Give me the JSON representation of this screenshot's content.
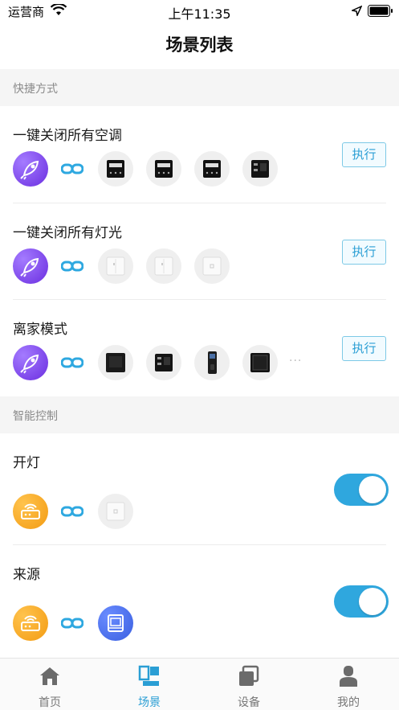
{
  "status_bar": {
    "carrier": "运营商",
    "time": "上午11:35"
  },
  "nav": {
    "title": "场景列表"
  },
  "sections": {
    "shortcuts": "快捷方式",
    "smart": "智能控制"
  },
  "shortcuts": [
    {
      "title": "一键关闭所有空调",
      "action": "执行",
      "devices": [
        "thermostat",
        "thermostat",
        "thermostat",
        "control-panel"
      ]
    },
    {
      "title": "一键关闭所有灯光",
      "action": "执行",
      "devices": [
        "light-switch",
        "light-switch",
        "light-switch"
      ]
    },
    {
      "title": "离家模式",
      "action": "执行",
      "devices": [
        "square-panel",
        "control-panel",
        "door-lock",
        "square-panel"
      ],
      "more": "···"
    }
  ],
  "smart_controls": [
    {
      "title": "开灯",
      "enabled": true,
      "devices": [
        "light-switch"
      ]
    },
    {
      "title": "来源",
      "enabled": true,
      "devices": [
        "blue-device"
      ]
    }
  ],
  "tab_bar": {
    "tabs": [
      {
        "label": "首页",
        "icon": "home-icon",
        "active": false
      },
      {
        "label": "场景",
        "icon": "scene-icon",
        "active": true
      },
      {
        "label": "设备",
        "icon": "devices-icon",
        "active": false
      },
      {
        "label": "我的",
        "icon": "profile-icon",
        "active": false
      }
    ]
  },
  "colors": {
    "accent": "#2a9ed4",
    "toggle_on": "#2fa7de",
    "rocket": "#7b4ef0",
    "router": "#f6a623",
    "section_bg": "#f5f5f5"
  }
}
